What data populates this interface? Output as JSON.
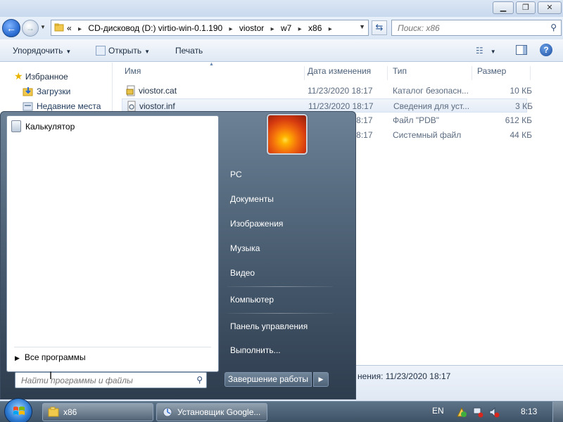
{
  "explorer": {
    "address": {
      "crumbs": [
        "CD-дисковод (D:) virtio-win-0.1.190",
        "viostor",
        "w7",
        "x86"
      ],
      "overflow": "«"
    },
    "search_placeholder": "Поиск: x86",
    "toolbar": {
      "organize": "Упорядочить",
      "open": "Открыть",
      "print": "Печать"
    },
    "nav": {
      "favorites": "Избранное",
      "downloads": "Загрузки",
      "recent": "Недавние места"
    },
    "columns": {
      "name": "Имя",
      "date": "Дата изменения",
      "type": "Тип",
      "size": "Размер"
    },
    "files": [
      {
        "name": "viostor.cat",
        "date": "11/23/2020 18:17",
        "type": "Каталог безопасн...",
        "size": "10 КБ"
      },
      {
        "name": "viostor.inf",
        "date": "11/23/2020 18:17",
        "type": "Сведения для уст...",
        "size": "3 КБ"
      },
      {
        "name": "",
        "date": "11/23/2020 18:17",
        "type": "Файл \"PDB\"",
        "size": "612 КБ"
      },
      {
        "name": "",
        "date": "11/23/2020 18:17",
        "type": "Системный файл",
        "size": "44 КБ"
      }
    ],
    "details_date": "нения: 11/23/2020 18:17"
  },
  "startmenu": {
    "programs": {
      "calculator": "Калькулятор",
      "all_programs": "Все программы"
    },
    "search_placeholder": "Найти программы и файлы",
    "links": {
      "pc": "PC",
      "documents": "Документы",
      "pictures": "Изображения",
      "music": "Музыка",
      "video": "Видео",
      "computer": "Компьютер",
      "control_panel": "Панель управления",
      "run": "Выполнить..."
    },
    "shutdown": "Завершение работы"
  },
  "taskbar": {
    "tasks": [
      {
        "label": "x86"
      },
      {
        "label": "Установщик Google..."
      }
    ],
    "language": "EN",
    "clock": "8:13"
  },
  "colors": {
    "accent": "#2a6bd1",
    "startmenu_dark": "#2e3d4e",
    "taskbar": "#3e5266"
  },
  "icons": [
    "back-arrow-icon",
    "forward-arrow-icon",
    "folder-icon",
    "refresh-icon",
    "search-icon",
    "star-icon",
    "downloads-folder-icon",
    "recent-places-icon",
    "catalog-file-icon",
    "setup-info-file-icon",
    "calculator-icon",
    "windows-flag-icon",
    "help-icon",
    "views-icon",
    "preview-pane-icon",
    "action-center-icon",
    "network-icon",
    "volume-muted-icon"
  ]
}
